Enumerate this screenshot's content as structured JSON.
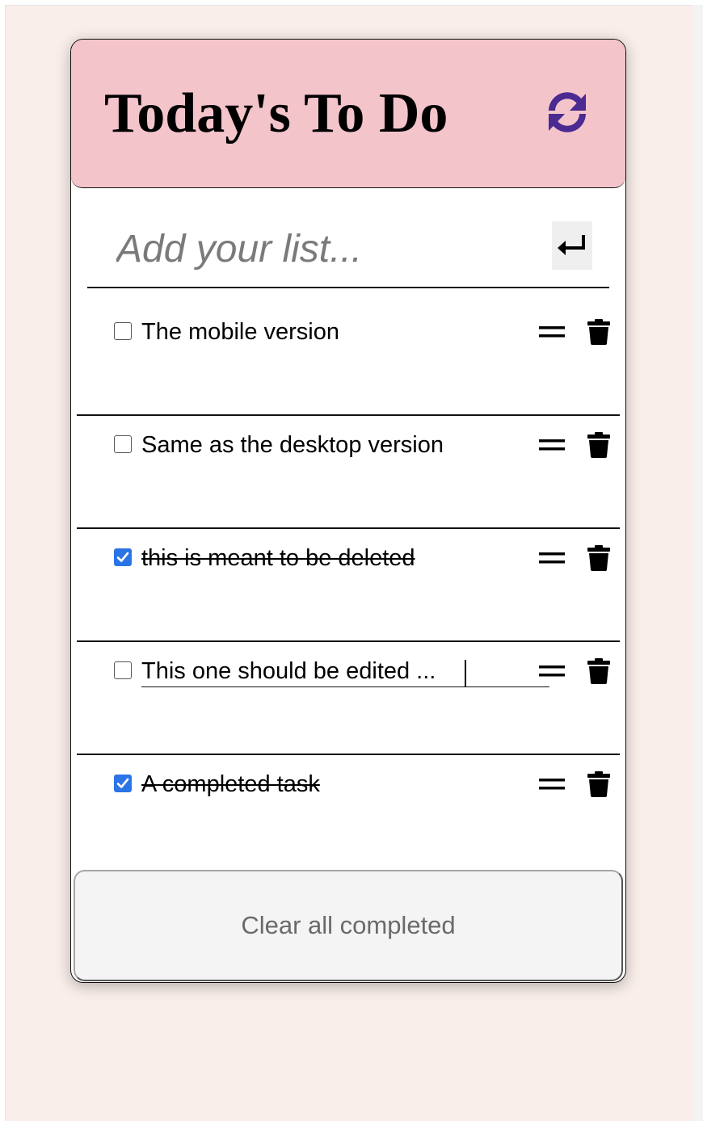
{
  "app": {
    "title": "Today's To Do",
    "refresh_icon": "refresh-icon",
    "accent_color": "#4b2a91",
    "header_color": "#f4c4cb"
  },
  "add": {
    "placeholder": "Add your list...",
    "value": "",
    "enter_icon": "enter-return-icon"
  },
  "todos": [
    {
      "text": "The mobile version",
      "completed": false,
      "editing": false
    },
    {
      "text": "Same as the desktop version",
      "completed": false,
      "editing": false
    },
    {
      "text": "this is meant to be deleted",
      "completed": true,
      "editing": false
    },
    {
      "text": "This one should be edited ...",
      "completed": false,
      "editing": true
    },
    {
      "text": "A completed task",
      "completed": true,
      "editing": false
    }
  ],
  "item_icons": {
    "drag": "drag-handle-icon",
    "delete": "trash-icon"
  },
  "footer": {
    "clear_label": "Clear all completed"
  }
}
